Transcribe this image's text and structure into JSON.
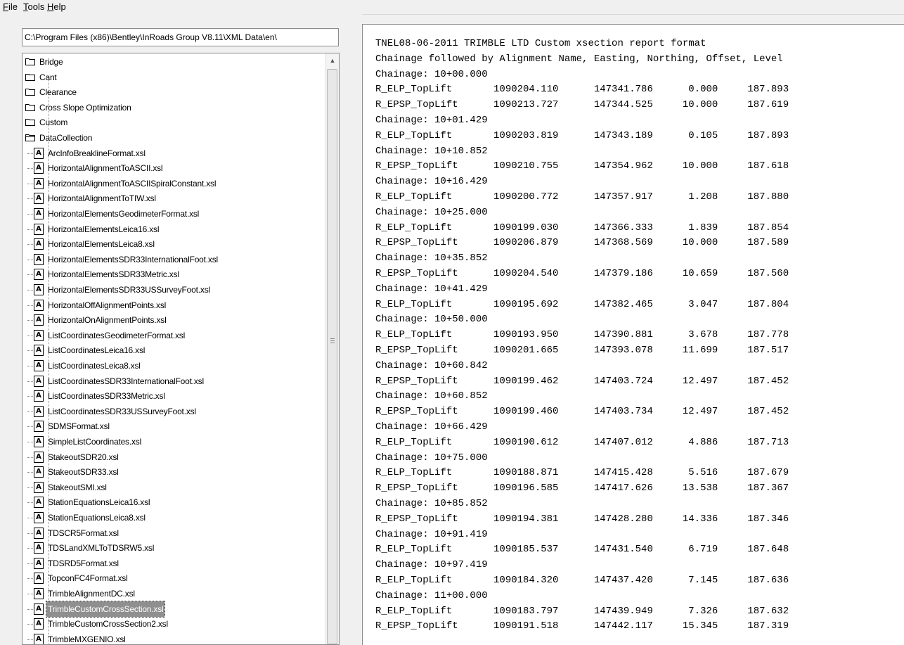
{
  "menu": [
    "File",
    "Tools",
    "Help"
  ],
  "menu_accel": [
    "F",
    "T",
    "H"
  ],
  "path": "C:\\Program Files (x86)\\Bentley\\InRoads Group V8.11\\XML Data\\en\\",
  "folders": [
    "Bridge",
    "Cant",
    "Clearance",
    "Cross Slope Optimization",
    "Custom"
  ],
  "open_folder": "DataCollection",
  "files": [
    "ArcInfoBreaklineFormat.xsl",
    "HorizontalAlignmentToASCII.xsl",
    "HorizontalAlignmentToASCIISpiralConstant.xsl",
    "HorizontalAlignmentToTIW.xsl",
    "HorizontalElementsGeodimeterFormat.xsl",
    "HorizontalElementsLeica16.xsl",
    "HorizontalElementsLeica8.xsl",
    "HorizontalElementsSDR33InternationalFoot.xsl",
    "HorizontalElementsSDR33Metric.xsl",
    "HorizontalElementsSDR33USSurveyFoot.xsl",
    "HorizontalOffAlignmentPoints.xsl",
    "HorizontalOnAlignmentPoints.xsl",
    "ListCoordinatesGeodimeterFormat.xsl",
    "ListCoordinatesLeica16.xsl",
    "ListCoordinatesLeica8.xsl",
    "ListCoordinatesSDR33InternationalFoot.xsl",
    "ListCoordinatesSDR33Metric.xsl",
    "ListCoordinatesSDR33USSurveyFoot.xsl",
    "SDMSFormat.xsl",
    "SimpleListCoordinates.xsl",
    "StakeoutSDR20.xsl",
    "StakeoutSDR33.xsl",
    "StakeoutSMI.xsl",
    "StationEquationsLeica16.xsl",
    "StationEquationsLeica8.xsl",
    "TDSCR5Format.xsl",
    "TDSLandXMLToTDSRW5.xsl",
    "TDSRD5Format.xsl",
    "TopconFC4Format.xsl",
    "TrimbleAlignmentDC.xsl",
    "TrimbleCustomCrossSection.xsl",
    "TrimbleCustomCrossSection2.xsl",
    "TrimbleMXGENIO.xsl"
  ],
  "selected_file": "TrimbleCustomCrossSection.xsl",
  "report_lines": [
    "TNEL08-06-2011 TRIMBLE LTD Custom xsection report format",
    "Chainage followed by Alignment Name, Easting, Northing, Offset, Level",
    "Chainage: 10+00.000",
    "R_ELP_TopLift       1090204.110      147341.786      0.000     187.893",
    "R_EPSP_TopLift      1090213.727      147344.525     10.000     187.619",
    "Chainage: 10+01.429",
    "R_ELP_TopLift       1090203.819      147343.189      0.105     187.893",
    "Chainage: 10+10.852",
    "R_EPSP_TopLift      1090210.755      147354.962     10.000     187.618",
    "Chainage: 10+16.429",
    "R_ELP_TopLift       1090200.772      147357.917      1.208     187.880",
    "Chainage: 10+25.000",
    "R_ELP_TopLift       1090199.030      147366.333      1.839     187.854",
    "R_EPSP_TopLift      1090206.879      147368.569     10.000     187.589",
    "Chainage: 10+35.852",
    "R_EPSP_TopLift      1090204.540      147379.186     10.659     187.560",
    "Chainage: 10+41.429",
    "R_ELP_TopLift       1090195.692      147382.465      3.047     187.804",
    "Chainage: 10+50.000",
    "R_ELP_TopLift       1090193.950      147390.881      3.678     187.778",
    "R_EPSP_TopLift      1090201.665      147393.078     11.699     187.517",
    "Chainage: 10+60.842",
    "R_EPSP_TopLift      1090199.462      147403.724     12.497     187.452",
    "Chainage: 10+60.852",
    "R_EPSP_TopLift      1090199.460      147403.734     12.497     187.452",
    "Chainage: 10+66.429",
    "R_ELP_TopLift       1090190.612      147407.012      4.886     187.713",
    "Chainage: 10+75.000",
    "R_ELP_TopLift       1090188.871      147415.428      5.516     187.679",
    "R_EPSP_TopLift      1090196.585      147417.626     13.538     187.367",
    "Chainage: 10+85.852",
    "R_EPSP_TopLift      1090194.381      147428.280     14.336     187.346",
    "Chainage: 10+91.419",
    "R_ELP_TopLift       1090185.537      147431.540      6.719     187.648",
    "Chainage: 10+97.419",
    "R_ELP_TopLift       1090184.320      147437.420      7.145     187.636",
    "Chainage: 11+00.000",
    "R_ELP_TopLift       1090183.797      147439.949      7.326     187.632",
    "R_EPSP_TopLift      1090191.518      147442.117     15.345     187.319"
  ]
}
